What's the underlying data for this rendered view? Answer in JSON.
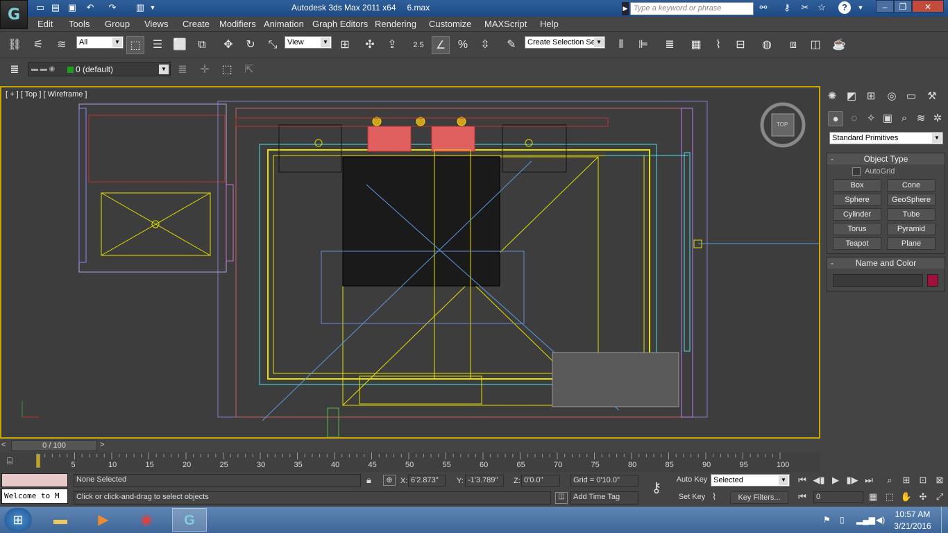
{
  "window": {
    "title": "Autodesk 3ds Max  2011 x64",
    "filename": "6.max"
  },
  "search": {
    "placeholder": "Type a keyword or phrase"
  },
  "menu": [
    "Edit",
    "Tools",
    "Group",
    "Views",
    "Create",
    "Modifiers",
    "Animation",
    "Graph Editors",
    "Rendering",
    "Customize",
    "MAXScript",
    "Help"
  ],
  "toolbar": {
    "selection_filter": "All",
    "ref_coord": "View",
    "snap_value": "2.5",
    "named_selection": "Create Selection Se"
  },
  "layer": {
    "current": "0 (default)"
  },
  "viewport": {
    "label": "[ + ] [ Top ] [ Wireframe ]",
    "viewcube_face": "TOP"
  },
  "command_panel": {
    "category": "Standard Primitives",
    "object_type_header": "Object Type",
    "autogrid_label": "AutoGrid",
    "buttons": [
      "Box",
      "Cone",
      "Sphere",
      "GeoSphere",
      "Cylinder",
      "Tube",
      "Torus",
      "Pyramid",
      "Teapot",
      "Plane"
    ],
    "name_color_header": "Name and Color",
    "object_color": "#a0103a"
  },
  "time": {
    "frame_display": "0 / 100",
    "ticks": [
      "5",
      "10",
      "15",
      "20",
      "25",
      "30",
      "35",
      "40",
      "45",
      "50",
      "55",
      "60",
      "65",
      "70",
      "75",
      "80",
      "85",
      "90",
      "95",
      "100"
    ]
  },
  "status": {
    "listener_text": "Welcome to M",
    "selection_text": "None Selected",
    "prompt_text": "Click or click-and-drag to select objects",
    "x_label": "X:",
    "x_value": "6'2.873\"",
    "y_label": "Y:",
    "y_value": "-1'3.789\"",
    "z_label": "Z:",
    "z_value": "0'0.0\"",
    "grid_text": "Grid = 0'10.0\"",
    "add_time_tag": "Add Time Tag",
    "auto_key": "Auto Key",
    "set_key": "Set Key",
    "key_filters": "Key Filters...",
    "selected_dropdown": "Selected",
    "frame_value": "0"
  },
  "taskbar": {
    "time": "10:57 AM",
    "date": "3/21/2016"
  }
}
